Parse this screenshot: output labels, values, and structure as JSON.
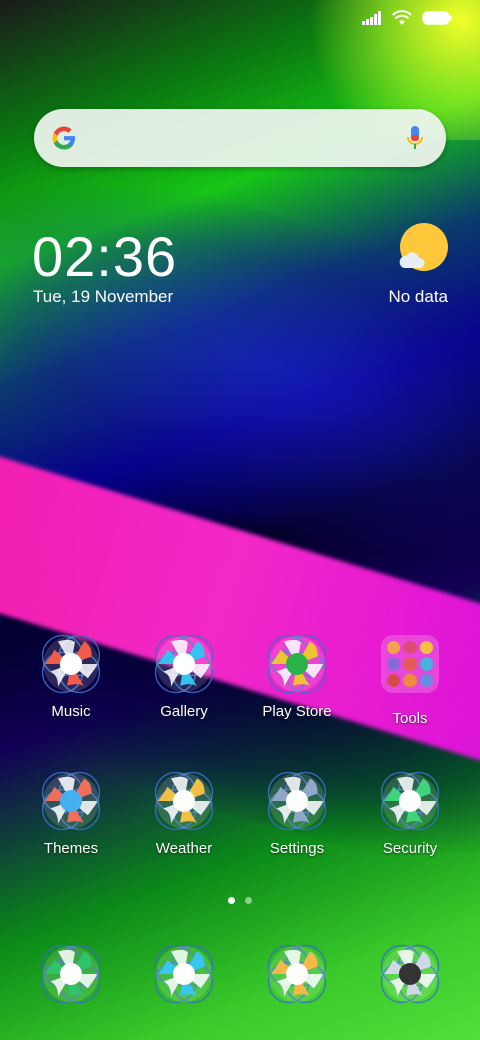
{
  "status_bar": {
    "icons": [
      "signal-icon",
      "wifi-icon",
      "battery-icon"
    ]
  },
  "search_bar": {
    "logo": "google-g-icon",
    "voice": "mic-icon"
  },
  "clock_widget": {
    "time": "02:36",
    "date": "Tue, 19 November"
  },
  "weather_widget": {
    "icon": "sun-cloud-icon",
    "text": "No data"
  },
  "apps_row1": [
    {
      "label": "Music",
      "name": "music",
      "color": "#f25a4a",
      "center": "#ffffff"
    },
    {
      "label": "Gallery",
      "name": "gallery",
      "color": "#36c2f0",
      "center": "#ffffff"
    },
    {
      "label": "Play Store",
      "name": "play-store",
      "color": "#f0c430",
      "center": "#2bb34a"
    },
    {
      "label": "Tools",
      "name": "tools",
      "color": "#ffffff",
      "center": "#ffffff"
    }
  ],
  "apps_row2": [
    {
      "label": "Themes",
      "name": "themes",
      "color": "#f06e5a",
      "center": "#44b0f0"
    },
    {
      "label": "Weather",
      "name": "weather",
      "color": "#f3c043",
      "center": "#ffffff"
    },
    {
      "label": "Settings",
      "name": "settings",
      "color": "#8fa8c8",
      "center": "#ffffff"
    },
    {
      "label": "Security",
      "name": "security",
      "color": "#3fd47a",
      "center": "#ffffff"
    }
  ],
  "dock": [
    {
      "name": "phone",
      "color": "#2fc46a"
    },
    {
      "name": "messages",
      "color": "#37c7f2"
    },
    {
      "name": "browser",
      "color": "#f7b84a"
    },
    {
      "name": "camera",
      "color": "#d0d8e8"
    }
  ],
  "page_indicator": {
    "count": 2,
    "active": 0
  }
}
